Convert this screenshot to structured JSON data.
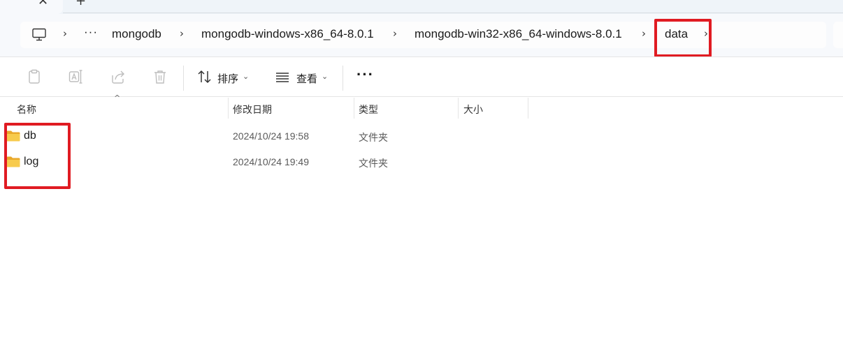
{
  "tabs": {
    "close_glyph": "✕",
    "new_glyph": "+"
  },
  "address_bar": {
    "root_icon": "this-pc-icon",
    "overflow": "···",
    "separator": "›",
    "crumbs": [
      "mongodb",
      "mongodb-windows-x86_64-8.0.1",
      "mongodb-win32-x86_64-windows-8.0.1",
      "data"
    ]
  },
  "command_bar": {
    "icons": [
      "copy-icon",
      "rename-icon",
      "share-icon",
      "delete-icon"
    ],
    "sort_label": "排序",
    "view_label": "查看",
    "more_label": "···",
    "chevron": "⌄"
  },
  "columns": {
    "name": "名称",
    "date_modified": "修改日期",
    "type": "类型",
    "size": "大小",
    "sort_caret": "^"
  },
  "files": [
    {
      "name": "db",
      "date_modified": "2024/10/24 19:58",
      "type": "文件夹",
      "size": ""
    },
    {
      "name": "log",
      "date_modified": "2024/10/24 19:49",
      "type": "文件夹",
      "size": ""
    }
  ],
  "colors": {
    "highlight": "#e01b22",
    "folder": "#f5c342"
  }
}
